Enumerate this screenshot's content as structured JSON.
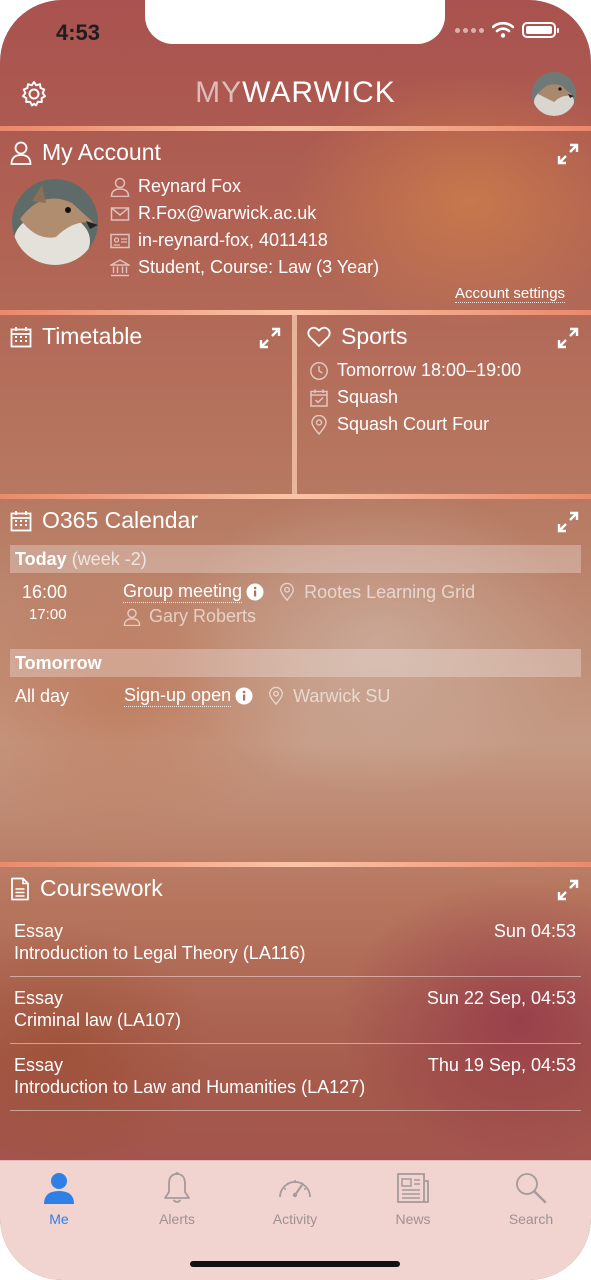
{
  "status_bar": {
    "time": "4:53"
  },
  "header": {
    "brand_my": "MY",
    "brand_warwick": "WARWICK"
  },
  "account": {
    "title": "My Account",
    "name": "Reynard Fox",
    "email": "R.Fox@warwick.ac.uk",
    "id": "in-reynard-fox, 4011418",
    "course": "Student, Course: Law (3 Year)",
    "settings_link": "Account settings"
  },
  "timetable": {
    "title": "Timetable"
  },
  "sports": {
    "title": "Sports",
    "time": "Tomorrow 18:00–19:00",
    "activity": "Squash",
    "location": "Squash Court Four"
  },
  "calendar": {
    "title": "O365 Calendar",
    "today": {
      "label": "Today",
      "week": "(week -2)"
    },
    "event1": {
      "start": "16:00",
      "end": "17:00",
      "title": "Group meeting",
      "location": "Rootes Learning Grid",
      "organiser": "Gary Roberts"
    },
    "tomorrow": {
      "label": "Tomorrow"
    },
    "event2": {
      "when": "All day",
      "title": "Sign-up open",
      "location": "Warwick SU"
    }
  },
  "coursework": {
    "title": "Coursework",
    "items": [
      {
        "type": "Essay",
        "module": "Introduction to Legal Theory (LA116)",
        "due": "Sun 04:53"
      },
      {
        "type": "Essay",
        "module": "Criminal law (LA107)",
        "due": "Sun 22 Sep, 04:53"
      },
      {
        "type": "Essay",
        "module": "Introduction to Law and Humanities (LA127)",
        "due": "Thu 19 Sep, 04:53"
      }
    ]
  },
  "tabs": [
    {
      "label": "Me",
      "icon": "person-icon",
      "active": true
    },
    {
      "label": "Alerts",
      "icon": "bell-icon"
    },
    {
      "label": "Activity",
      "icon": "speedometer-icon"
    },
    {
      "label": "News",
      "icon": "newspaper-icon"
    },
    {
      "label": "Search",
      "icon": "search-icon"
    }
  ],
  "colors": {
    "active_tab": "#2f80e6",
    "inactive_tab": "#9e9294",
    "tabbar_bg": "#f6dad6"
  }
}
